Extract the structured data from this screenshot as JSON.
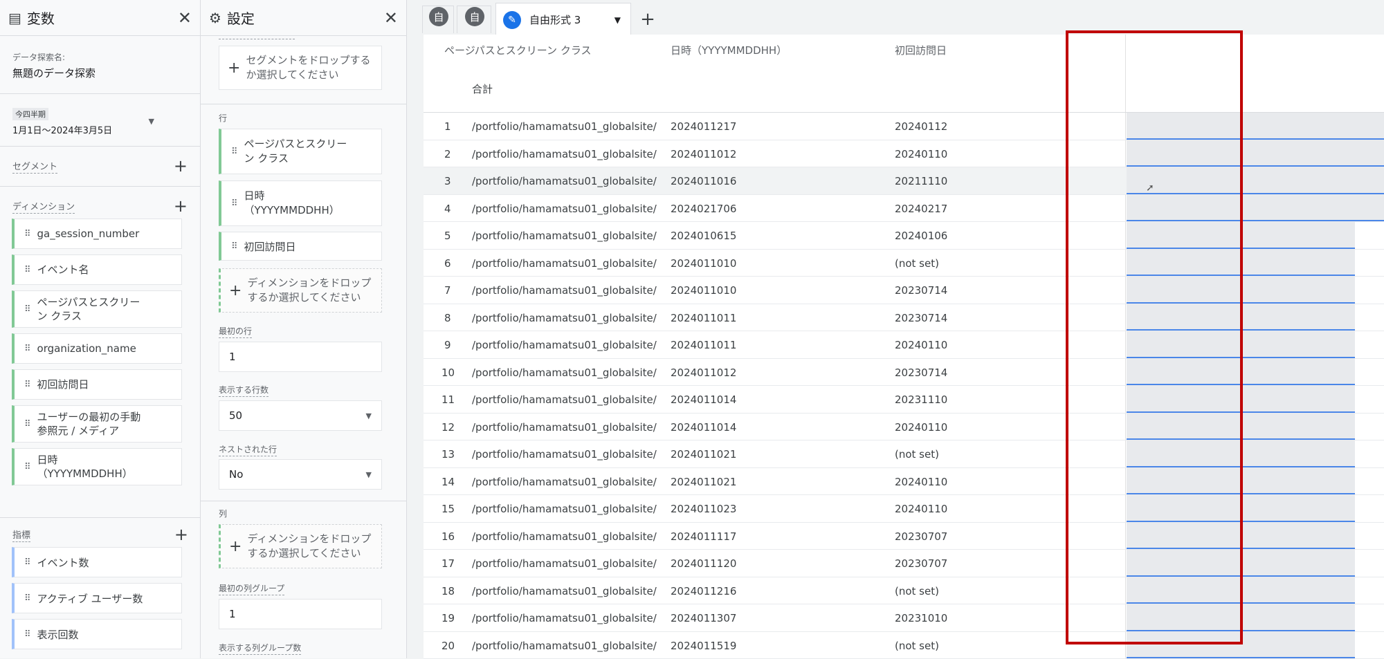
{
  "variables": {
    "title": "変数",
    "exploration_name_label": "データ探索名:",
    "exploration_name": "無題のデータ探索",
    "date_badge": "今四半期",
    "date_range": "1月1日〜2024年3月5日",
    "segments_label": "セグメント",
    "dimensions_label": "ディメンション",
    "dimensions": [
      [
        "ga_session_number"
      ],
      [
        "イベント名"
      ],
      [
        "ページパスとスクリー",
        "ン クラス"
      ],
      [
        "organization_name"
      ],
      [
        "初回訪問日"
      ],
      [
        "ユーザーの最初の手動",
        "参照元 / メディア"
      ],
      [
        "日時",
        "（YYYYMMDDHH）"
      ]
    ],
    "metrics_label": "指標",
    "metrics": [
      "イベント数",
      "アクティブ ユーザー数",
      "表示回数"
    ]
  },
  "settings": {
    "title": "設定",
    "segment_drop": [
      "セグメントをドロップする",
      "か選択してください"
    ],
    "rows_label": "行",
    "row_dims": [
      [
        "ページパスとスクリー",
        "ン クラス"
      ],
      [
        "日時",
        "（YYYYMMDDHH）"
      ],
      [
        "初回訪問日"
      ]
    ],
    "dim_drop": [
      "ディメンションをドロップ",
      "するか選択してください"
    ],
    "start_row_label": "最初の行",
    "start_row": "1",
    "show_rows_label": "表示する行数",
    "show_rows": "50",
    "nested_rows_label": "ネストされた行",
    "nested_rows": "No",
    "columns_label": "列",
    "col_drop": [
      "ディメンションをドロップ",
      "するか選択してください"
    ],
    "first_col_group_label": "最初の列グループ",
    "first_col_group": "1",
    "show_col_groups_label": "表示する列グループ数"
  },
  "tabs": {
    "icon_glyph": "自",
    "active_label": "自由形式 3",
    "add": "+"
  },
  "table": {
    "col1": "ページパスとスクリーン クラス",
    "col2": "日時（YYYYMMDDHH）",
    "col3": "初回訪問日",
    "total_label": "合計",
    "rows": [
      [
        "1",
        "/portfolio/hamamatsu01_globalsite/",
        "2024011217",
        "20240112"
      ],
      [
        "2",
        "/portfolio/hamamatsu01_globalsite/",
        "2024011012",
        "20240110"
      ],
      [
        "3",
        "/portfolio/hamamatsu01_globalsite/",
        "2024011016",
        "20211110"
      ],
      [
        "4",
        "/portfolio/hamamatsu01_globalsite/",
        "2024021706",
        "20240217"
      ],
      [
        "5",
        "/portfolio/hamamatsu01_globalsite/",
        "2024010615",
        "20240106"
      ],
      [
        "6",
        "/portfolio/hamamatsu01_globalsite/",
        "2024011010",
        "(not set)"
      ],
      [
        "7",
        "/portfolio/hamamatsu01_globalsite/",
        "2024011010",
        "20230714"
      ],
      [
        "8",
        "/portfolio/hamamatsu01_globalsite/",
        "2024011011",
        "20230714"
      ],
      [
        "9",
        "/portfolio/hamamatsu01_globalsite/",
        "2024011011",
        "20240110"
      ],
      [
        "10",
        "/portfolio/hamamatsu01_globalsite/",
        "2024011012",
        "20230714"
      ],
      [
        "11",
        "/portfolio/hamamatsu01_globalsite/",
        "2024011014",
        "20231110"
      ],
      [
        "12",
        "/portfolio/hamamatsu01_globalsite/",
        "2024011014",
        "20240110"
      ],
      [
        "13",
        "/portfolio/hamamatsu01_globalsite/",
        "2024011021",
        "(not set)"
      ],
      [
        "14",
        "/portfolio/hamamatsu01_globalsite/",
        "2024011021",
        "20240110"
      ],
      [
        "15",
        "/portfolio/hamamatsu01_globalsite/",
        "2024011023",
        "20240110"
      ],
      [
        "16",
        "/portfolio/hamamatsu01_globalsite/",
        "2024011117",
        "20230707"
      ],
      [
        "17",
        "/portfolio/hamamatsu01_globalsite/",
        "2024011120",
        "20230707"
      ],
      [
        "18",
        "/portfolio/hamamatsu01_globalsite/",
        "2024011216",
        "(not set)"
      ],
      [
        "19",
        "/portfolio/hamamatsu01_globalsite/",
        "2024011307",
        "20231010"
      ],
      [
        "20",
        "/portfolio/hamamatsu01_globalsite/",
        "2024011519",
        "(not set)"
      ]
    ]
  }
}
